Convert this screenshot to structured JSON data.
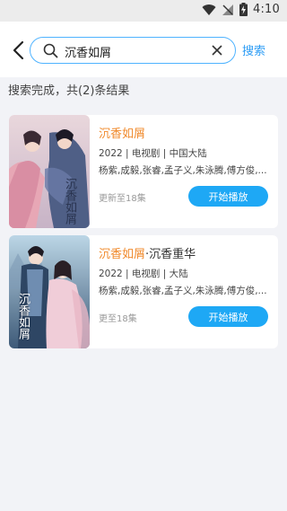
{
  "status_bar": {
    "time": "4:10",
    "icons": [
      "wifi-icon",
      "signal-off-icon",
      "battery-charging-icon"
    ]
  },
  "header": {
    "back_icon": "chevron-left-icon",
    "search": {
      "icon": "search-icon",
      "value": "沉香如屑",
      "clear_icon": "close-icon"
    },
    "search_button": "搜索"
  },
  "results": {
    "summary": "搜索完成，共(2)条结果",
    "items": [
      {
        "title_highlight": "沉香如屑",
        "title_rest": "",
        "meta": "2022 | 电视剧 | 中国大陆",
        "cast": "杨紫,成毅,张睿,孟子义,朱泳腾,傅方俊,...",
        "episodes": "更新至18集",
        "play_label": "开始播放",
        "poster_text": "沉香如屑"
      },
      {
        "title_highlight": "沉香如屑",
        "title_rest": "·沉香重华",
        "meta": "2022 | 电视剧 | 大陆",
        "cast": "杨紫,成毅,张睿,孟子义,朱泳腾,傅方俊,...",
        "episodes": "更至18集",
        "play_label": "开始播放",
        "poster_text": "沉香如屑"
      }
    ]
  },
  "colors": {
    "accent": "#1ea8f5",
    "highlight": "#f08a2c",
    "background": "#f2f3f7"
  }
}
